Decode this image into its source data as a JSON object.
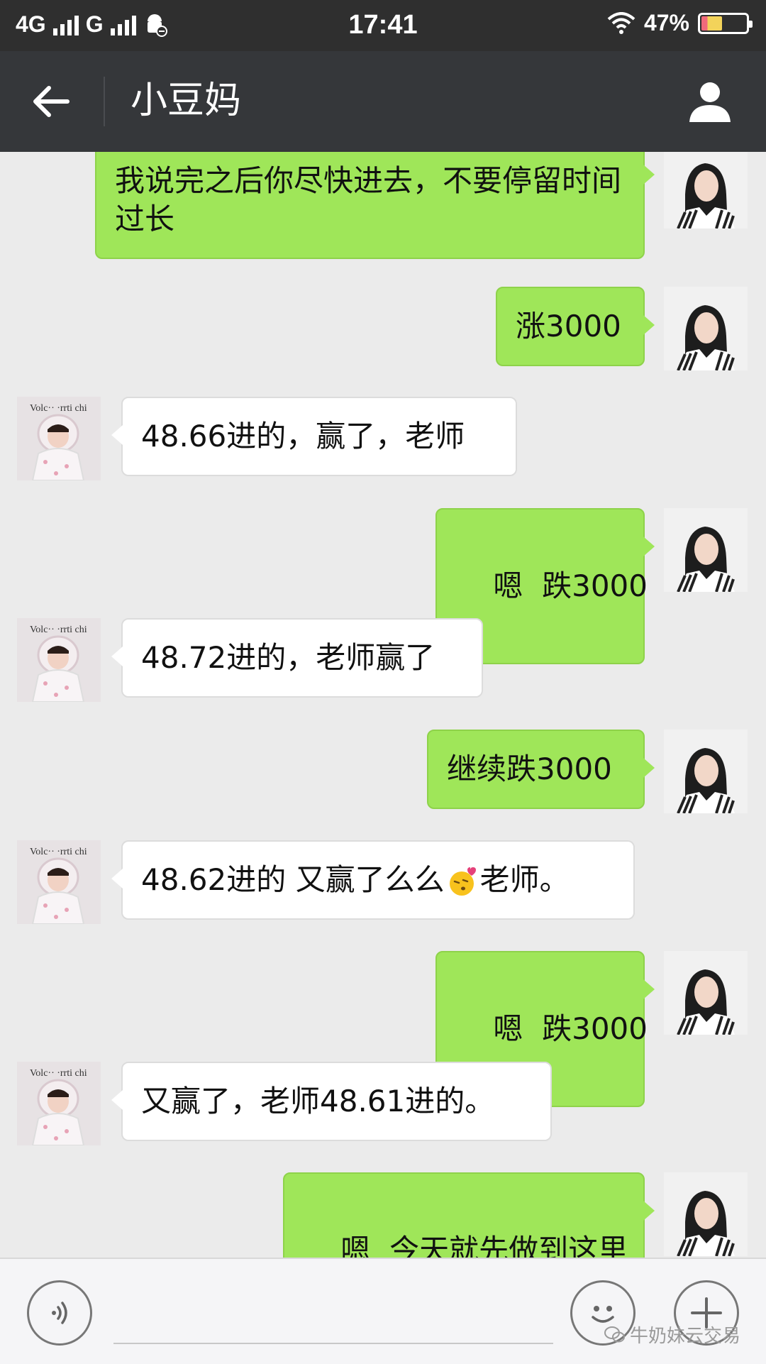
{
  "status_bar": {
    "network_1": "4G",
    "network_2": "G",
    "time": "17:41",
    "battery": "47%",
    "battery_level": 0.47
  },
  "title_bar": {
    "title": "小豆妈"
  },
  "messages": [
    {
      "sender": "me",
      "text": "我说完之后你尽快进去，不要停留时间过长"
    },
    {
      "sender": "me",
      "text": "涨3000"
    },
    {
      "sender": "other",
      "text": "48.66进的，赢了，老师"
    },
    {
      "sender": "me",
      "text": "嗯  跌3000"
    },
    {
      "sender": "other",
      "text": "48.72进的，老师赢了"
    },
    {
      "sender": "me",
      "text": "继续跌3000"
    },
    {
      "sender": "other",
      "text_before": "48.62进的 又赢了么么",
      "emoji": "kiss-face-emoji",
      "text_after": "老师。"
    },
    {
      "sender": "me",
      "text": "嗯  跌3000"
    },
    {
      "sender": "other",
      "text": "又赢了，老师48.61进的。"
    },
    {
      "sender": "me",
      "text": "嗯  今天就先做到这里"
    }
  ],
  "avatar_text": {
    "other": "Volcs"
  },
  "input_bar": {
    "watermark": "牛奶妹云交易"
  },
  "colors": {
    "my_bubble": "#9fe659",
    "other_bubble": "#ffffff",
    "title_bar": "#35373a",
    "status_bar": "#2f2f2f",
    "background": "#ebebeb"
  },
  "icons": {
    "back": "back-arrow-icon",
    "contact": "person-icon",
    "voice": "voice-icon",
    "emoji": "emoji-icon",
    "plus": "plus-icon",
    "wifi": "wifi-icon",
    "android": "android-icon"
  }
}
